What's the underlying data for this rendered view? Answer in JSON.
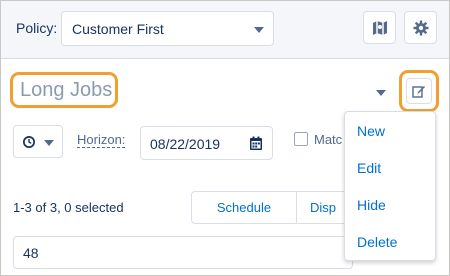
{
  "header": {
    "policy_label": "Policy:",
    "policy_value": "Customer First",
    "buttons": [
      "map-icon",
      "gear-icon"
    ]
  },
  "list": {
    "title": "Long Jobs",
    "menu_items": [
      "New",
      "Edit",
      "Hide",
      "Delete"
    ]
  },
  "controls": {
    "horizon_label": "Horizon:",
    "horizon_date": "08/22/2019",
    "match_label": "Matc"
  },
  "results": {
    "count": "1-3 of 3, 0 selected",
    "schedule_label": "Schedule",
    "disp_label": "Disp",
    "row_value": "48"
  },
  "colors": {
    "highlight": "#f0a030",
    "link": "#0070d2",
    "text": "#16325c",
    "header_bg": "#f4f6f9"
  }
}
